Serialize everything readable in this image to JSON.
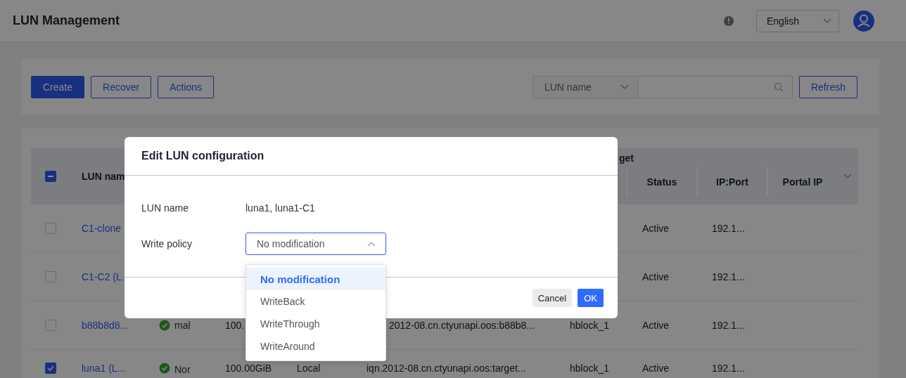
{
  "header": {
    "title": "LUN Management",
    "language": "English"
  },
  "toolbar": {
    "buttons": [
      {
        "label": "Create",
        "kind": "primary"
      },
      {
        "label": "Recover",
        "kind": "outline"
      },
      {
        "label": "Actions",
        "kind": "outline"
      }
    ],
    "search_filter": "LUN name",
    "refresh": "Refresh"
  },
  "table": {
    "select_all_indeterminate": true,
    "name_heading": "LUN nam",
    "group_heading": "get",
    "columns": [
      "Status",
      "IP:Port",
      "Portal IP"
    ],
    "rows": [
      {
        "checked": false,
        "name": "C1-clone",
        "status": "Active",
        "ip_port": "192.1..."
      },
      {
        "checked": false,
        "name": "C1-C2 (L.",
        "status": "Active",
        "ip_port": "192.1..."
      },
      {
        "kind": "under-menu",
        "checked": false,
        "name": "b88b8d8...",
        "health": "mal",
        "capacity": "100.",
        "target": "2012-08.cn.ctyunapi.oos:b88b8...",
        "block": "hblock_1",
        "status": "Active",
        "ip_port": "192.1..."
      },
      {
        "kind": "plain",
        "checked": true,
        "name": "luna1 (L...",
        "health": "Nor",
        "capacity": "100.00GiB",
        "type": "Local",
        "target": "iqn.2012-08.cn.ctyunapi.oos:target...",
        "block": "hblock_1",
        "status": "Active",
        "ip_port": "192.1..."
      }
    ]
  },
  "dialog": {
    "title": "Edit LUN configuration",
    "fields": [
      {
        "kind": "text",
        "label": "LUN name",
        "value": "luna1, luna1-C1"
      },
      {
        "kind": "select",
        "label": "Write policy",
        "value": "No modification",
        "expanded": true,
        "options": [
          {
            "label": "No modification",
            "selected": true
          },
          {
            "label": "WriteBack",
            "selected": false
          },
          {
            "label": "WriteThrough",
            "selected": false
          },
          {
            "label": "WriteAround",
            "selected": false
          }
        ]
      }
    ],
    "cancel": "Cancel",
    "ok": "OK"
  }
}
